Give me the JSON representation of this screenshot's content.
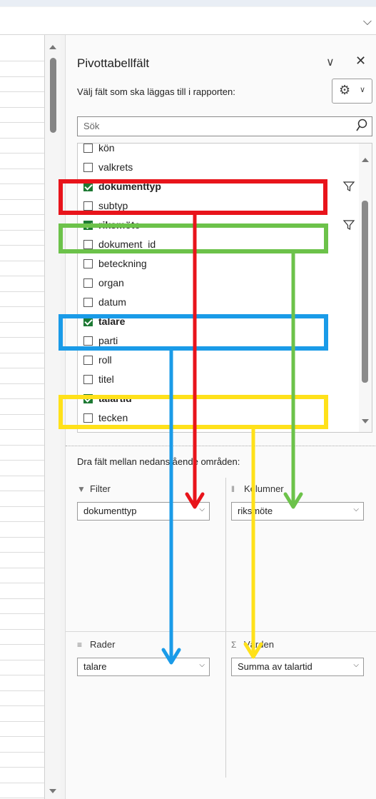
{
  "pane": {
    "title": "Pivottabellfält",
    "subtitle": "Välj fält som ska läggas till i rapporten:",
    "search_placeholder": "Sök"
  },
  "fields": [
    {
      "label": "kön",
      "checked": false,
      "bold": false,
      "filter": false
    },
    {
      "label": "valkrets",
      "checked": false,
      "bold": false,
      "filter": false
    },
    {
      "label": "dokumenttyp",
      "checked": true,
      "bold": true,
      "filter": true
    },
    {
      "label": "subtyp",
      "checked": false,
      "bold": false,
      "filter": false
    },
    {
      "label": "riksmöte",
      "checked": true,
      "bold": true,
      "filter": true
    },
    {
      "label": "dokument_id",
      "checked": false,
      "bold": false,
      "filter": false
    },
    {
      "label": "beteckning",
      "checked": false,
      "bold": false,
      "filter": false
    },
    {
      "label": "organ",
      "checked": false,
      "bold": false,
      "filter": false
    },
    {
      "label": "datum",
      "checked": false,
      "bold": false,
      "filter": false
    },
    {
      "label": "talare",
      "checked": true,
      "bold": true,
      "filter": false
    },
    {
      "label": "parti",
      "checked": false,
      "bold": false,
      "filter": false
    },
    {
      "label": "roll",
      "checked": false,
      "bold": false,
      "filter": false
    },
    {
      "label": "titel",
      "checked": false,
      "bold": false,
      "filter": false
    },
    {
      "label": "talartid",
      "checked": true,
      "bold": true,
      "filter": false
    },
    {
      "label": "tecken",
      "checked": false,
      "bold": false,
      "filter": false
    }
  ],
  "areas": {
    "instruction": "Dra fält mellan nedanstående områden:",
    "filter": {
      "label": "Filter",
      "value": "dokumenttyp"
    },
    "columns": {
      "label": "Kolumner",
      "value": "riksmöte"
    },
    "rows": {
      "label": "Rader",
      "value": "talare"
    },
    "values": {
      "label": "Värden",
      "value": "Summa av talartid"
    }
  },
  "annotation_colors": {
    "red": "#e8141b",
    "green": "#6cc24a",
    "blue": "#1a9be8",
    "yellow": "#ffe11a"
  }
}
